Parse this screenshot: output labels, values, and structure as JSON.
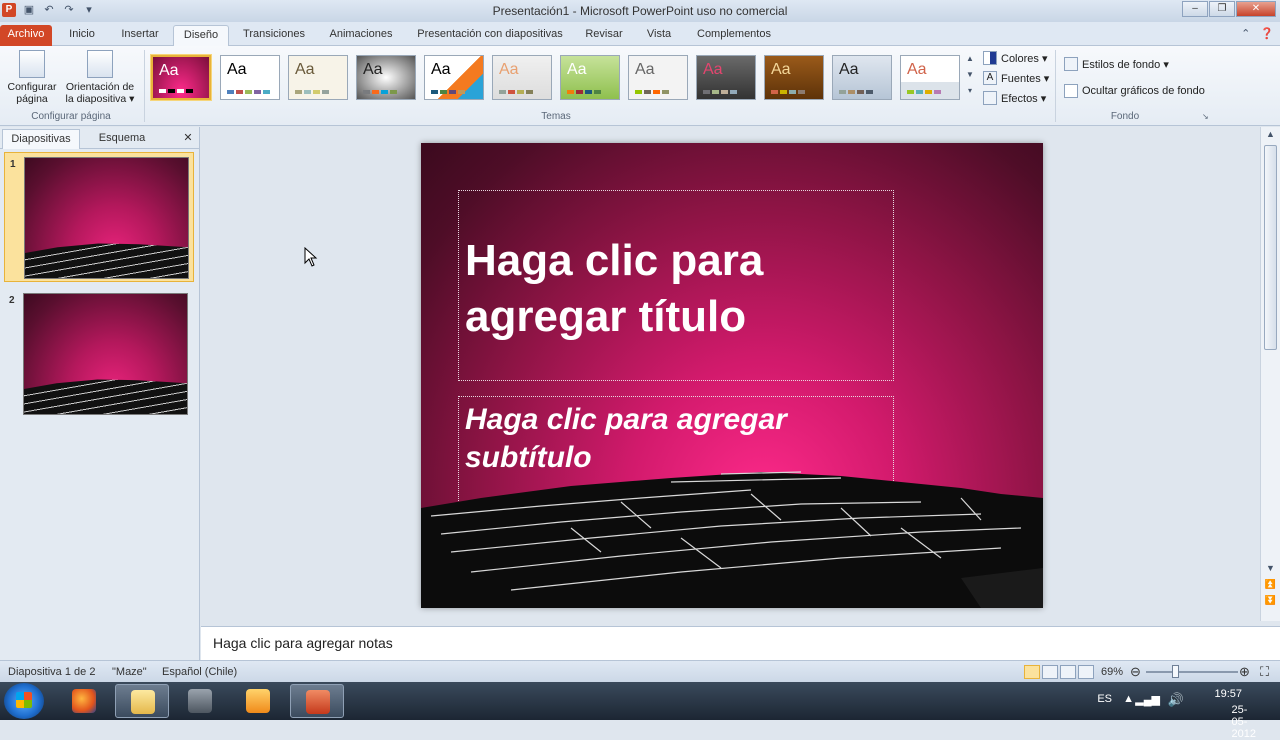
{
  "window": {
    "title": "Presentación1  -  Microsoft PowerPoint uso no comercial",
    "controls": [
      "–",
      "❐",
      "✕"
    ]
  },
  "tabs": [
    {
      "label": "Archivo"
    },
    {
      "label": "Inicio"
    },
    {
      "label": "Insertar"
    },
    {
      "label": "Diseño"
    },
    {
      "label": "Transiciones"
    },
    {
      "label": "Animaciones"
    },
    {
      "label": "Presentación con diapositivas"
    },
    {
      "label": "Revisar"
    },
    {
      "label": "Vista"
    },
    {
      "label": "Complementos"
    }
  ],
  "active_tab": "Diseño",
  "ribbon": {
    "page_setup": {
      "configurar_l1": "Configurar",
      "configurar_l2": "página",
      "orientacion_l1": "Orientación de",
      "orientacion_l2": "la diapositiva ▾",
      "group_label": "Configurar página"
    },
    "themes": {
      "group_label": "Temas",
      "sample": "Aa",
      "selected_index": 0
    },
    "theme_options": {
      "colores": "Colores ▾",
      "fuentes": "Fuentes ▾",
      "efectos": "Efectos ▾"
    },
    "background": {
      "estilos": "Estilos de fondo ▾",
      "ocultar": "Ocultar gráficos de fondo",
      "ocultar_checked": false,
      "group_label": "Fondo"
    }
  },
  "panel": {
    "tabs": [
      "Diapositivas",
      "Esquema"
    ],
    "close": "✕",
    "slides": [
      {
        "num": "1"
      },
      {
        "num": "2"
      }
    ]
  },
  "slide": {
    "title_l1": "Haga clic para",
    "title_l2": "agregar título",
    "subtitle_l1": "Haga clic para agregar",
    "subtitle_l2": "subtítulo"
  },
  "notes": {
    "placeholder": "Haga clic para agregar notas"
  },
  "status": {
    "slide_counter": "Diapositiva 1 de 2",
    "theme": "\"Maze\"",
    "language": "Español (Chile)",
    "zoom": "69%"
  },
  "tray": {
    "lang": "ES",
    "time": "19:57",
    "date": "25-05-2012"
  },
  "colors": {
    "file_tab": "#d24726",
    "selection": "#fbe29d",
    "slide_pink": "#e8237b"
  }
}
